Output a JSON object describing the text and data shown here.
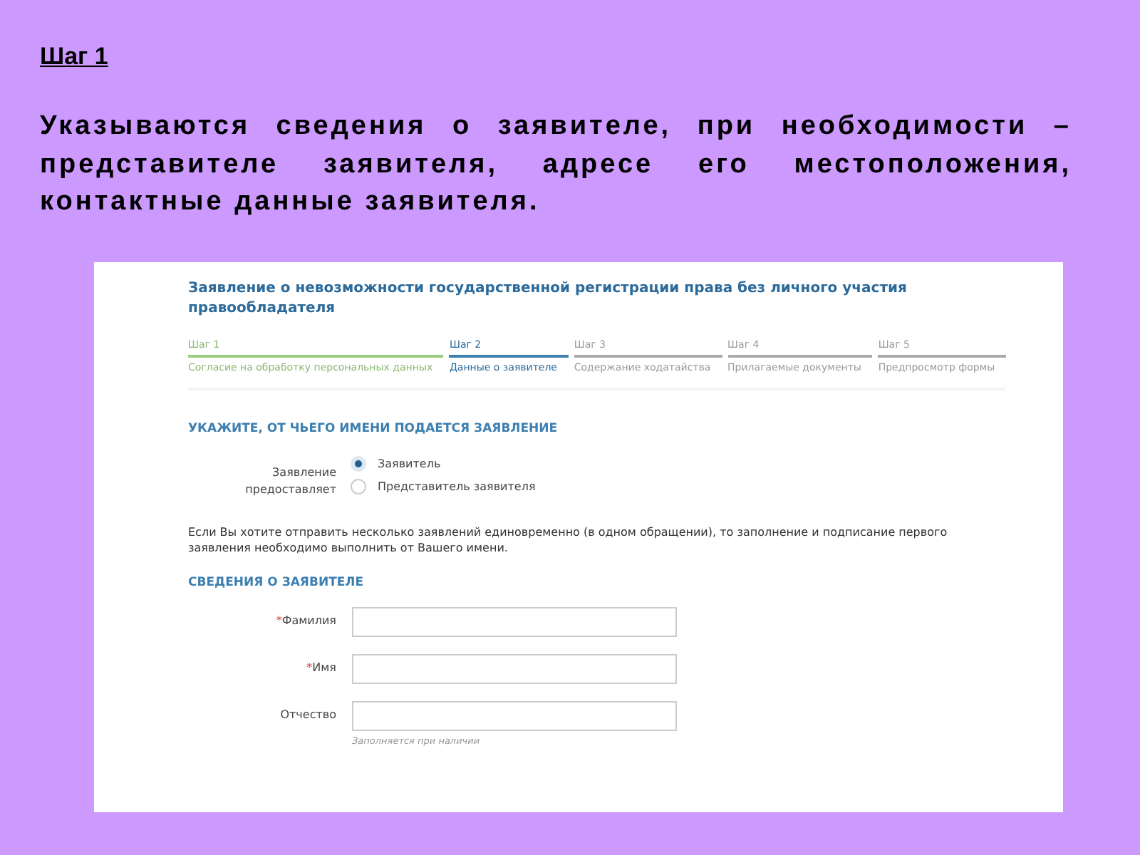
{
  "slide": {
    "heading": "Шаг 1",
    "text": "Указываются сведения о заявителе, при необходимости – представителе заявителя, адресе его местоположения, контактные данные заявителя."
  },
  "form": {
    "title": "Заявление о невозможности государственной регистрации права без личного участия правообладателя",
    "steps": [
      {
        "number": "Шаг 1",
        "label": "Согласие на обработку персональных данных",
        "done": true,
        "selected": false
      },
      {
        "number": "Шаг 2",
        "label": "Данные о заявителе",
        "done": false,
        "selected": true
      },
      {
        "number": "Шаг 3",
        "label": "Содержание ходатайства",
        "done": false,
        "selected": false
      },
      {
        "number": "Шаг 4",
        "label": "Прилагаемые документы",
        "done": false,
        "selected": false
      },
      {
        "number": "Шаг 5",
        "label": "Предпросмотр формы",
        "done": false,
        "selected": false
      }
    ],
    "applicant_section": {
      "heading": "УКАЖИТЕ, ОТ ЧЬЕГО ИМЕНИ ПОДАЕТСЯ ЗАЯВЛЕНИЕ",
      "label": "Заявление предоставляет",
      "options": [
        {
          "label": "Заявитель",
          "selected": true
        },
        {
          "label": "Представитель заявителя",
          "selected": false
        }
      ],
      "note": "Если Вы хотите отправить несколько заявлений единовременно (в одном обращении), то заполнение и подписание первого заявления необходимо выполнить от Вашего имени."
    },
    "info_section": {
      "heading": "СВЕДЕНИЯ О ЗАЯВИТЕЛЕ",
      "fields": [
        {
          "label": "Фамилия",
          "required_mark": "*"
        },
        {
          "label": "Имя",
          "required_mark": "*"
        },
        {
          "label": "Отчество",
          "hint": "Заполняется при наличии"
        }
      ]
    }
  }
}
